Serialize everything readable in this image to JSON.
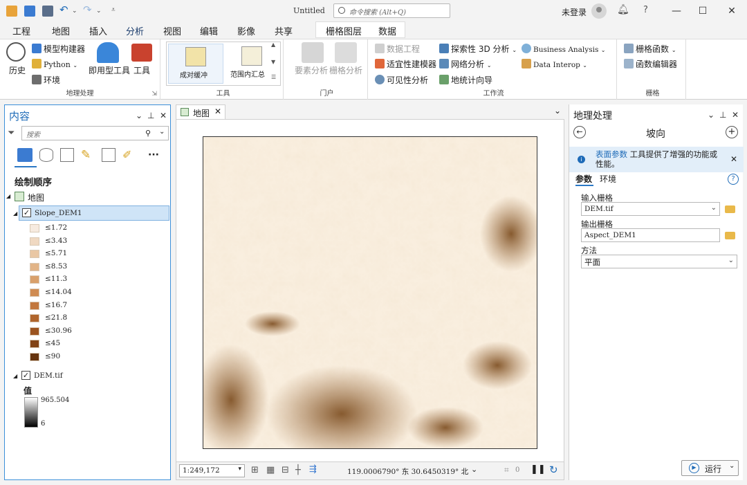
{
  "window": {
    "title": "Untitled",
    "search_placeholder": "命令搜索 (Alt+Q)",
    "signin": "未登录",
    "help": "?",
    "min": "—",
    "max": "☐",
    "close": "✕"
  },
  "tabs": [
    {
      "label": "工程"
    },
    {
      "label": "地图"
    },
    {
      "label": "插入"
    },
    {
      "label": "分析",
      "active": true
    },
    {
      "label": "视图"
    },
    {
      "label": "编辑"
    },
    {
      "label": "影像"
    },
    {
      "label": "共享"
    }
  ],
  "context_tabs": {
    "raster_layer": "栅格图层",
    "data": "数据"
  },
  "ribbon": {
    "geoprocessing": {
      "name": "地理处理",
      "history": "历史",
      "model_builder": "模型构建器",
      "python": "Python",
      "environments": "环境",
      "ready_tools": "即用型工具",
      "tools": "工具"
    },
    "tools": {
      "name": "工具",
      "gallery": [
        "成对缓冲",
        "范围内汇总"
      ]
    },
    "portal": {
      "name": "门户",
      "feature_analysis": "要素分析",
      "raster_analysis": "栅格分析"
    },
    "workflows": {
      "name": "工作流",
      "data_engineering": "数据工程",
      "suitability": "适宜性建模器",
      "visibility": "可见性分析",
      "exploratory_3d": "探索性 3D 分析",
      "network": "网络分析",
      "geostat": "地统计向导",
      "business": "Business Analysis",
      "data_interop": "Data Interop"
    },
    "raster": {
      "name": "栅格",
      "functions": "栅格函数",
      "function_editor": "函数编辑器"
    }
  },
  "contents": {
    "title": "内容",
    "search_placeholder": "搜索",
    "drawing_order": "绘制顺序",
    "map_name": "地图",
    "layer1": "Slope_DEM1",
    "legend": [
      "≤1.72",
      "≤3.43",
      "≤5.71",
      "≤8.53",
      "≤11.3",
      "≤14.04",
      "≤16.7",
      "≤21.8",
      "≤30.96",
      "≤45",
      "≤90"
    ],
    "legend_colors": [
      "#f7ebe0",
      "#f0d9c2",
      "#e9c7a4",
      "#e2b487",
      "#d9a06b",
      "#cf8b52",
      "#c2773d",
      "#b0652c",
      "#9b531f",
      "#824316",
      "#66340f"
    ],
    "layer2": "DEM.tif",
    "value_label": "值",
    "max_value": "965.504",
    "min_value": "6"
  },
  "map_view": {
    "tab": "地图",
    "scale": "1:249,172",
    "coords": "119.0006790° 东 30.6450319° 北",
    "selected_count": "0"
  },
  "geoprocessing_pane": {
    "title": "地理处理",
    "tool_name": "坡向",
    "info_link": "表面参数",
    "info_text": "工具提供了增强的功能或性能。",
    "tab_params": "参数",
    "tab_env": "环境",
    "input_label": "输入栅格",
    "input_value": "DEM.tif",
    "output_label": "输出栅格",
    "output_value": "Aspect_DEM1",
    "method_label": "方法",
    "method_value": "平面",
    "run_label": "运行"
  }
}
